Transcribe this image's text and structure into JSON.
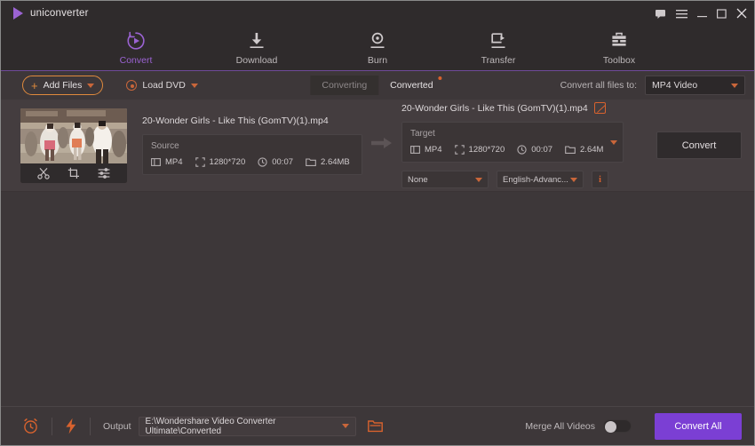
{
  "window": {
    "app_name": "uniconverter",
    "controls": [
      {
        "name": "feedback-icon",
        "glyph": "message"
      },
      {
        "name": "menu-icon",
        "glyph": "hamburger"
      },
      {
        "name": "minimize-icon",
        "glyph": "minimize"
      },
      {
        "name": "maximize-icon",
        "glyph": "maximize"
      },
      {
        "name": "close-icon",
        "glyph": "close"
      }
    ]
  },
  "nav": {
    "active": "Convert",
    "items": [
      {
        "label": "Convert",
        "icon": "convert-icon"
      },
      {
        "label": "Download",
        "icon": "download-icon"
      },
      {
        "label": "Burn",
        "icon": "burn-icon"
      },
      {
        "label": "Transfer",
        "icon": "transfer-icon"
      },
      {
        "label": "Toolbox",
        "icon": "toolbox-icon"
      }
    ]
  },
  "toolbar": {
    "add_files_label": "Add Files",
    "load_dvd_label": "Load DVD",
    "tab_converting": "Converting",
    "tab_converted": "Converted",
    "convert_all_to_label": "Convert all files to:",
    "output_format": "MP4 Video"
  },
  "file": {
    "source_filename": "20-Wonder Girls - Like This (GomTV)(1).mp4",
    "target_filename": "20-Wonder Girls - Like This (GomTV)(1).mp4",
    "source": {
      "caption": "Source",
      "format": "MP4",
      "resolution": "1280*720",
      "duration": "00:07",
      "size": "2.64MB"
    },
    "target": {
      "caption": "Target",
      "format": "MP4",
      "resolution": "1280*720",
      "duration": "00:07",
      "size": "2.64MB"
    },
    "subtitle_track": "None",
    "audio_track": "English-Advanc...",
    "convert_button": "Convert",
    "thumb_tools": [
      "trim-icon",
      "crop-icon",
      "effects-icon"
    ]
  },
  "bottom": {
    "output_label": "Output",
    "output_path": "E:\\Wondershare Video Converter Ultimate\\Converted",
    "merge_label": "Merge All Videos",
    "merge_enabled": false,
    "convert_all_label": "Convert All"
  },
  "colors": {
    "accent_purple": "#7b3fd4",
    "accent_orange": "#d8622e",
    "window_bg": "#2f2b2c",
    "content_bg": "#3d3739"
  }
}
